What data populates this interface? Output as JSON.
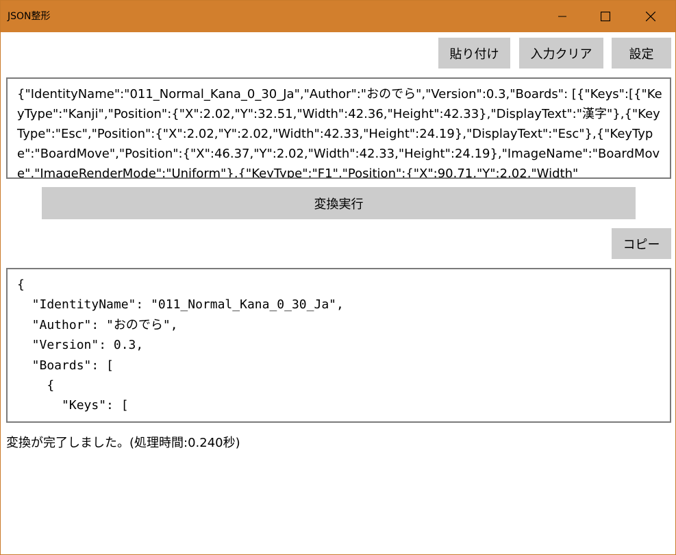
{
  "window": {
    "title": "JSON整形",
    "titlebar_color": "#d27f2d",
    "controls": {
      "minimize_icon": "minimize-icon",
      "maximize_icon": "maximize-icon",
      "close_icon": "close-icon"
    }
  },
  "toolbar": {
    "paste_label": "貼り付け",
    "clear_label": "入力クリア",
    "settings_label": "設定"
  },
  "input": {
    "value": "{\"IdentityName\":\"011_Normal_Kana_0_30_Ja\",\"Author\":\"おのでら\",\"Version\":0.3,\"Boards\": [{\"Keys\":[{\"KeyType\":\"Kanji\",\"Position\":{\"X\":2.02,\"Y\":32.51,\"Width\":42.36,\"Height\":42.33},\"DisplayText\":\"漢字\"},{\"KeyType\":\"Esc\",\"Position\":{\"X\":2.02,\"Y\":2.02,\"Width\":42.33,\"Height\":24.19},\"DisplayText\":\"Esc\"},{\"KeyType\":\"BoardMove\",\"Position\":{\"X\":46.37,\"Y\":2.02,\"Width\":42.33,\"Height\":24.19},\"ImageName\":\"BoardMove\",\"ImageRenderMode\":\"Uniform\"},{\"KeyType\":\"F1\",\"Position\":{\"X\":90.71,\"Y\":2.02,\"Width\""
  },
  "actions": {
    "convert_label": "変換実行",
    "copy_label": "コピー"
  },
  "output": {
    "value": "{\n  \"IdentityName\": \"011_Normal_Kana_0_30_Ja\",\n  \"Author\": \"おのでら\",\n  \"Version\": 0.3,\n  \"Boards\": [\n    {\n      \"Keys\": ["
  },
  "status": {
    "text": "変換が完了しました。(処理時間:0.240秒)"
  }
}
